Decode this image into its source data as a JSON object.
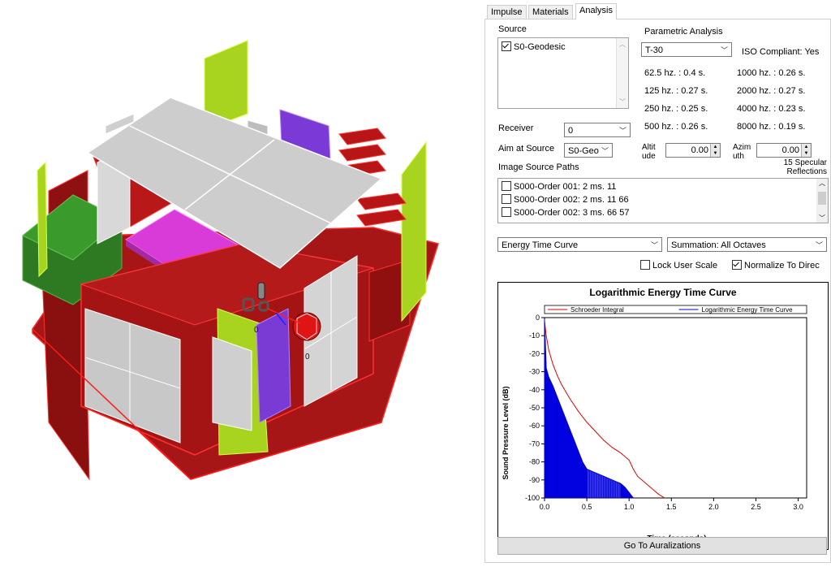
{
  "tabs": [
    "Impulse",
    "Materials",
    "Analysis"
  ],
  "active_tab": "Analysis",
  "viewport": {
    "labels": [
      "0",
      "0"
    ]
  },
  "source": {
    "label": "Source",
    "items": [
      {
        "name": "S0-Geodesic",
        "checked": true
      }
    ]
  },
  "parametric": {
    "label": "Parametric Analysis",
    "metric": "T-30",
    "iso": "ISO Compliant: Yes",
    "results_left": [
      "62.5 hz. : 0.4 s.",
      "125 hz. : 0.27 s.",
      "250 hz. : 0.25 s.",
      "500 hz. : 0.26 s."
    ],
    "results_right": [
      "1000 hz. : 0.26 s.",
      "2000 hz. : 0.27 s.",
      "4000 hz. : 0.23 s.",
      "8000 hz. : 0.19 s."
    ]
  },
  "receiver": {
    "label": "Receiver",
    "value": "0"
  },
  "aim": {
    "label": "Aim at Source",
    "value": "S0-Geo",
    "altitude_label_1": "Altit",
    "altitude_label_2": "ude",
    "altitude_value": "0.00",
    "azimuth_label_1": "Azim",
    "azimuth_label_2": "uth",
    "azimuth_value": "0.00",
    "specular_1": "15 Specular",
    "specular_2": "Reflections"
  },
  "image_source": {
    "label": "Image Source Paths",
    "items": [
      "S000-Order 001: 2 ms. 11",
      "S000-Order 002: 2 ms. 11 66",
      "S000-Order 002: 3 ms. 66 57"
    ]
  },
  "curve_select": "Energy Time Curve",
  "summation_select": "Summation: All Octaves",
  "lock_user_scale": {
    "label": "Lock User Scale",
    "checked": false
  },
  "normalize": {
    "label": "Normalize  To Direc",
    "checked": true
  },
  "chart_data": {
    "type": "line",
    "title": "Logarithmic Energy Time Curve",
    "xlabel": "Time (seconds)",
    "ylabel": "Sound Pressure Level (dB)",
    "xlim": [
      0.0,
      3.1
    ],
    "ylim": [
      -100,
      0
    ],
    "xticks": [
      "0.0",
      "0.5",
      "1.0",
      "1.5",
      "2.0",
      "2.5",
      "3.0"
    ],
    "yticks": [
      "0",
      "-10",
      "-20",
      "-30",
      "-40",
      "-50",
      "-60",
      "-70",
      "-80",
      "-90",
      "-100"
    ],
    "legend_placement": "top",
    "series": [
      {
        "name": "Schroeder Integral",
        "color": "#e00000",
        "x": [
          0.0,
          0.02,
          0.05,
          0.1,
          0.15,
          0.2,
          0.3,
          0.4,
          0.5,
          0.6,
          0.7,
          0.8,
          0.9,
          1.0,
          1.05,
          1.1,
          1.2,
          1.3,
          1.35,
          1.42
        ],
        "y": [
          -2,
          -10,
          -18,
          -26,
          -32,
          -37,
          -45,
          -52,
          -58,
          -63,
          -68,
          -72,
          -75,
          -79,
          -84,
          -88,
          -92,
          -96,
          -98,
          -100
        ]
      },
      {
        "name": "Logarithmic Energy Time Curve",
        "color": "#0000e0",
        "x": [
          0.0,
          0.02,
          0.05,
          0.1,
          0.15,
          0.2,
          0.25,
          0.3,
          0.35,
          0.4,
          0.45,
          0.5,
          0.6,
          0.7,
          0.8,
          0.9,
          0.95,
          1.0,
          1.05
        ],
        "y": [
          -1,
          -28,
          -33,
          -38,
          -44,
          -50,
          -56,
          -62,
          -68,
          -74,
          -80,
          -84,
          -86,
          -88,
          -90,
          -92,
          -94,
          -97,
          -100
        ]
      }
    ]
  },
  "auralization_button": "Go To Auralizations",
  "colors": {
    "red": "#a11212",
    "green_face": "#2a7a1a",
    "lime": "#a6d41e",
    "magenta": "#d63bd6",
    "violet": "#7a3bd4",
    "grey_panel": "#c9c9c9"
  }
}
